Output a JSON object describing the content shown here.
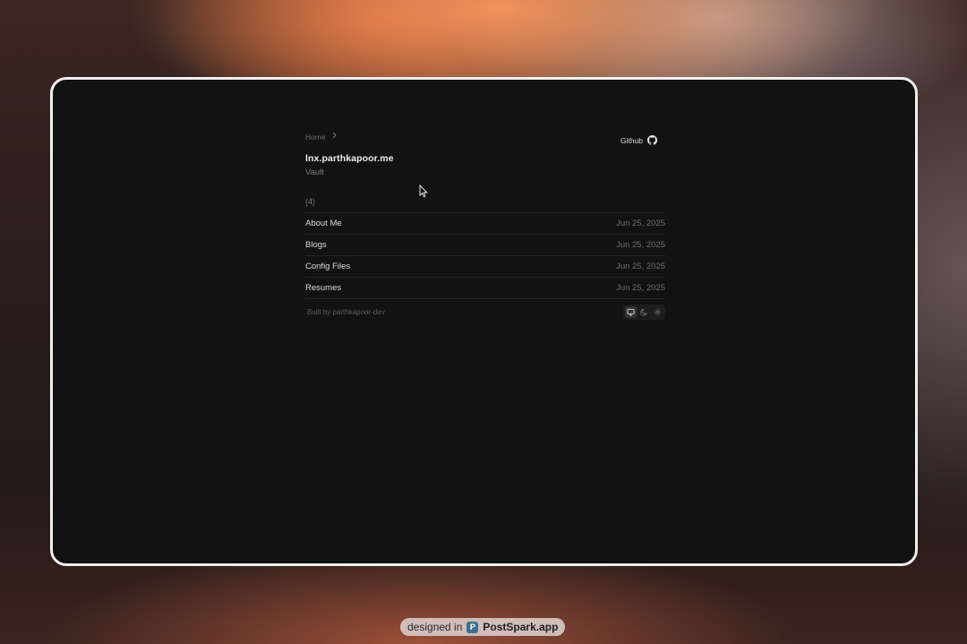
{
  "breadcrumb": {
    "home": "Home"
  },
  "header": {
    "github_label": "Github",
    "title": "lnx.parthkapoor.me",
    "subtitle": "Vault"
  },
  "listing": {
    "count": "(4)",
    "items": [
      {
        "name": "About Me",
        "date": "Jun 25, 2025"
      },
      {
        "name": "Blogs",
        "date": "Jun 25, 2025"
      },
      {
        "name": "Config Files",
        "date": "Jun 25, 2025"
      },
      {
        "name": "Resumes",
        "date": "Jun 25, 2025"
      }
    ]
  },
  "footer": {
    "built_by": "Built by parthkapoor-dev",
    "theme_options": [
      "monitor-icon",
      "moon-icon",
      "sun-icon"
    ],
    "theme_selected": "monitor-icon"
  },
  "watermark": {
    "prefix": "designed in",
    "brand": "PostSpark.app",
    "logo_letter": "P"
  },
  "colors": {
    "window_bg": "#121212",
    "frame_border": "#f1efee",
    "accent_glow": "#f0965f"
  }
}
